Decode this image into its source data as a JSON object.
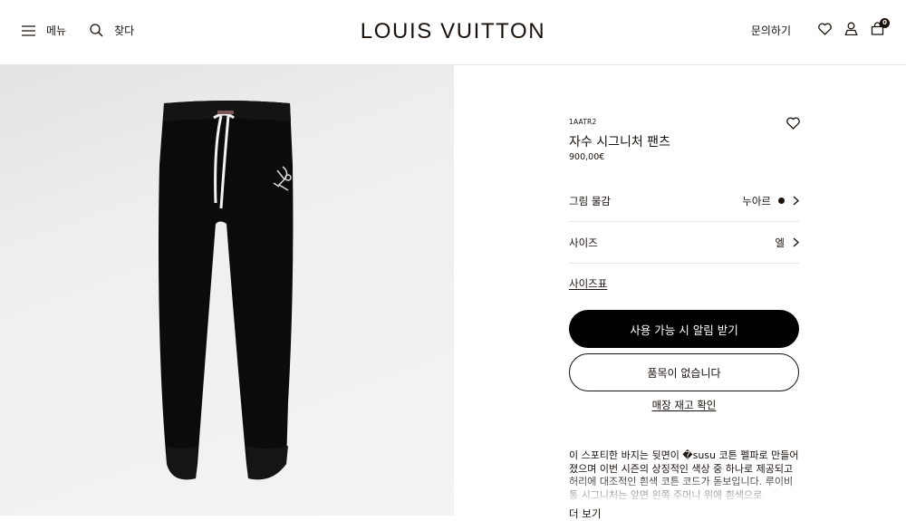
{
  "header": {
    "menu_label": "메뉴",
    "search_label": "찾다",
    "logo": "LOUIS VUITTON",
    "contact_label": "문의하기",
    "bag_count": "0"
  },
  "product": {
    "sku": "1AATR2",
    "name": "자수 시그니처 팬츠",
    "price": "900,00€",
    "material_label": "그림 물감",
    "material_value": "누아르",
    "material_color": "#19110b",
    "size_label": "사이즈",
    "size_value": "엘",
    "size_chart_link": "사이즈표",
    "notify_button": "사용 가능 시 알림 받기",
    "out_of_stock_button": "품목이 없습니다",
    "store_stock_link": "매장 재고 확인",
    "description": "이 스포티한 바지는 뒷면이 �susu 코튼 펠파로 만들어졌으며 이번 시즌의 상징적인 색상 중 하나로 제공되고 허리에 대조적인 흰색 코튼 코드가 돋보입니다. 루이비통 시그니처는 앞면 왼쪽 주머니 위에 흰색으로",
    "more_link": "더 보기"
  },
  "colors": {
    "text": "#19110b",
    "divider": "#e6e6e6",
    "button_bg": "#000000"
  }
}
